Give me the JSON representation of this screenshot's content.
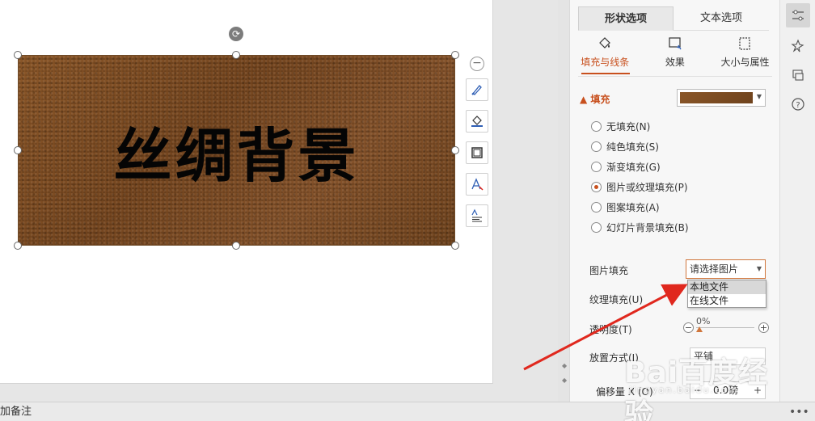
{
  "slide": {
    "shape_text": "丝绸背景"
  },
  "notes": {
    "label": "加备注"
  },
  "panel": {
    "tabs": [
      {
        "label": "形状选项",
        "active": true
      },
      {
        "label": "文本选项",
        "active": false
      }
    ],
    "subtabs": [
      {
        "label": "填充与线条",
        "icon": "paint-bucket-icon",
        "active": true
      },
      {
        "label": "效果",
        "icon": "effects-icon",
        "active": false
      },
      {
        "label": "大小与属性",
        "icon": "size-properties-icon",
        "active": false
      }
    ],
    "fill": {
      "header": "填充",
      "options": [
        {
          "label": "无填充(N)",
          "checked": false
        },
        {
          "label": "纯色填充(S)",
          "checked": false
        },
        {
          "label": "渐变填充(G)",
          "checked": false
        },
        {
          "label": "图片或纹理填充(P)",
          "checked": true
        },
        {
          "label": "图案填充(A)",
          "checked": false
        },
        {
          "label": "幻灯片背景填充(B)",
          "checked": false
        }
      ],
      "picture_fill_label": "图片填充",
      "picture_select_value": "请选择图片",
      "picture_dropdown": [
        "本地文件",
        "在线文件"
      ],
      "texture_fill_label": "纹理填充(U)",
      "transparency_label": "透明度(T)",
      "transparency_value": "0%",
      "layout_label": "放置方式(I)",
      "layout_value": "平铺",
      "offset_label": "偏移量 X (O)",
      "offset_value": "0.0磅"
    }
  },
  "toolbar": {
    "icons": [
      "properties-icon",
      "pin-icon",
      "animation-icon",
      "help-icon"
    ],
    "more": "•••"
  },
  "watermark": {
    "main": "Bai百度经验",
    "sub": "jingyan.baidu.com"
  },
  "colors": {
    "accent": "#c8501e",
    "leather": "#7f4d22",
    "arrow": "#e0281e"
  }
}
